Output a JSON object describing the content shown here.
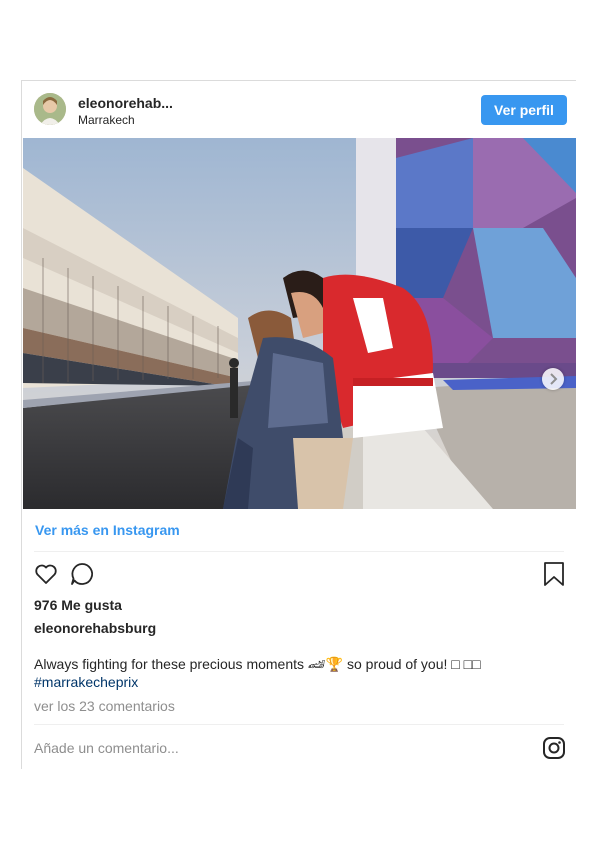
{
  "post": {
    "username": "eleonorehab...",
    "location": "Marrakech",
    "profile_button": "Ver perfil",
    "view_more_link": "Ver más en Instagram",
    "likes_text": "976 Me gusta",
    "caption_username": "eleonorehabsburg",
    "caption_text": "Always fighting for these precious moments 🏎🏆 so proud of you! □ □□",
    "caption_hashtag": "#marrakecheprix",
    "comments_link": "ver los 23 comentarios",
    "comment_placeholder": "Añade un comentario..."
  },
  "icons": {
    "like": "heart-icon",
    "comment": "comment-bubble-icon",
    "save": "bookmark-icon",
    "instagram": "instagram-logo-icon",
    "carousel_next": "chevron-right-icon"
  },
  "colors": {
    "button_blue": "#3897f0",
    "link_blue": "#3897f0",
    "hashtag": "#003569",
    "muted": "#8e8e8e"
  }
}
